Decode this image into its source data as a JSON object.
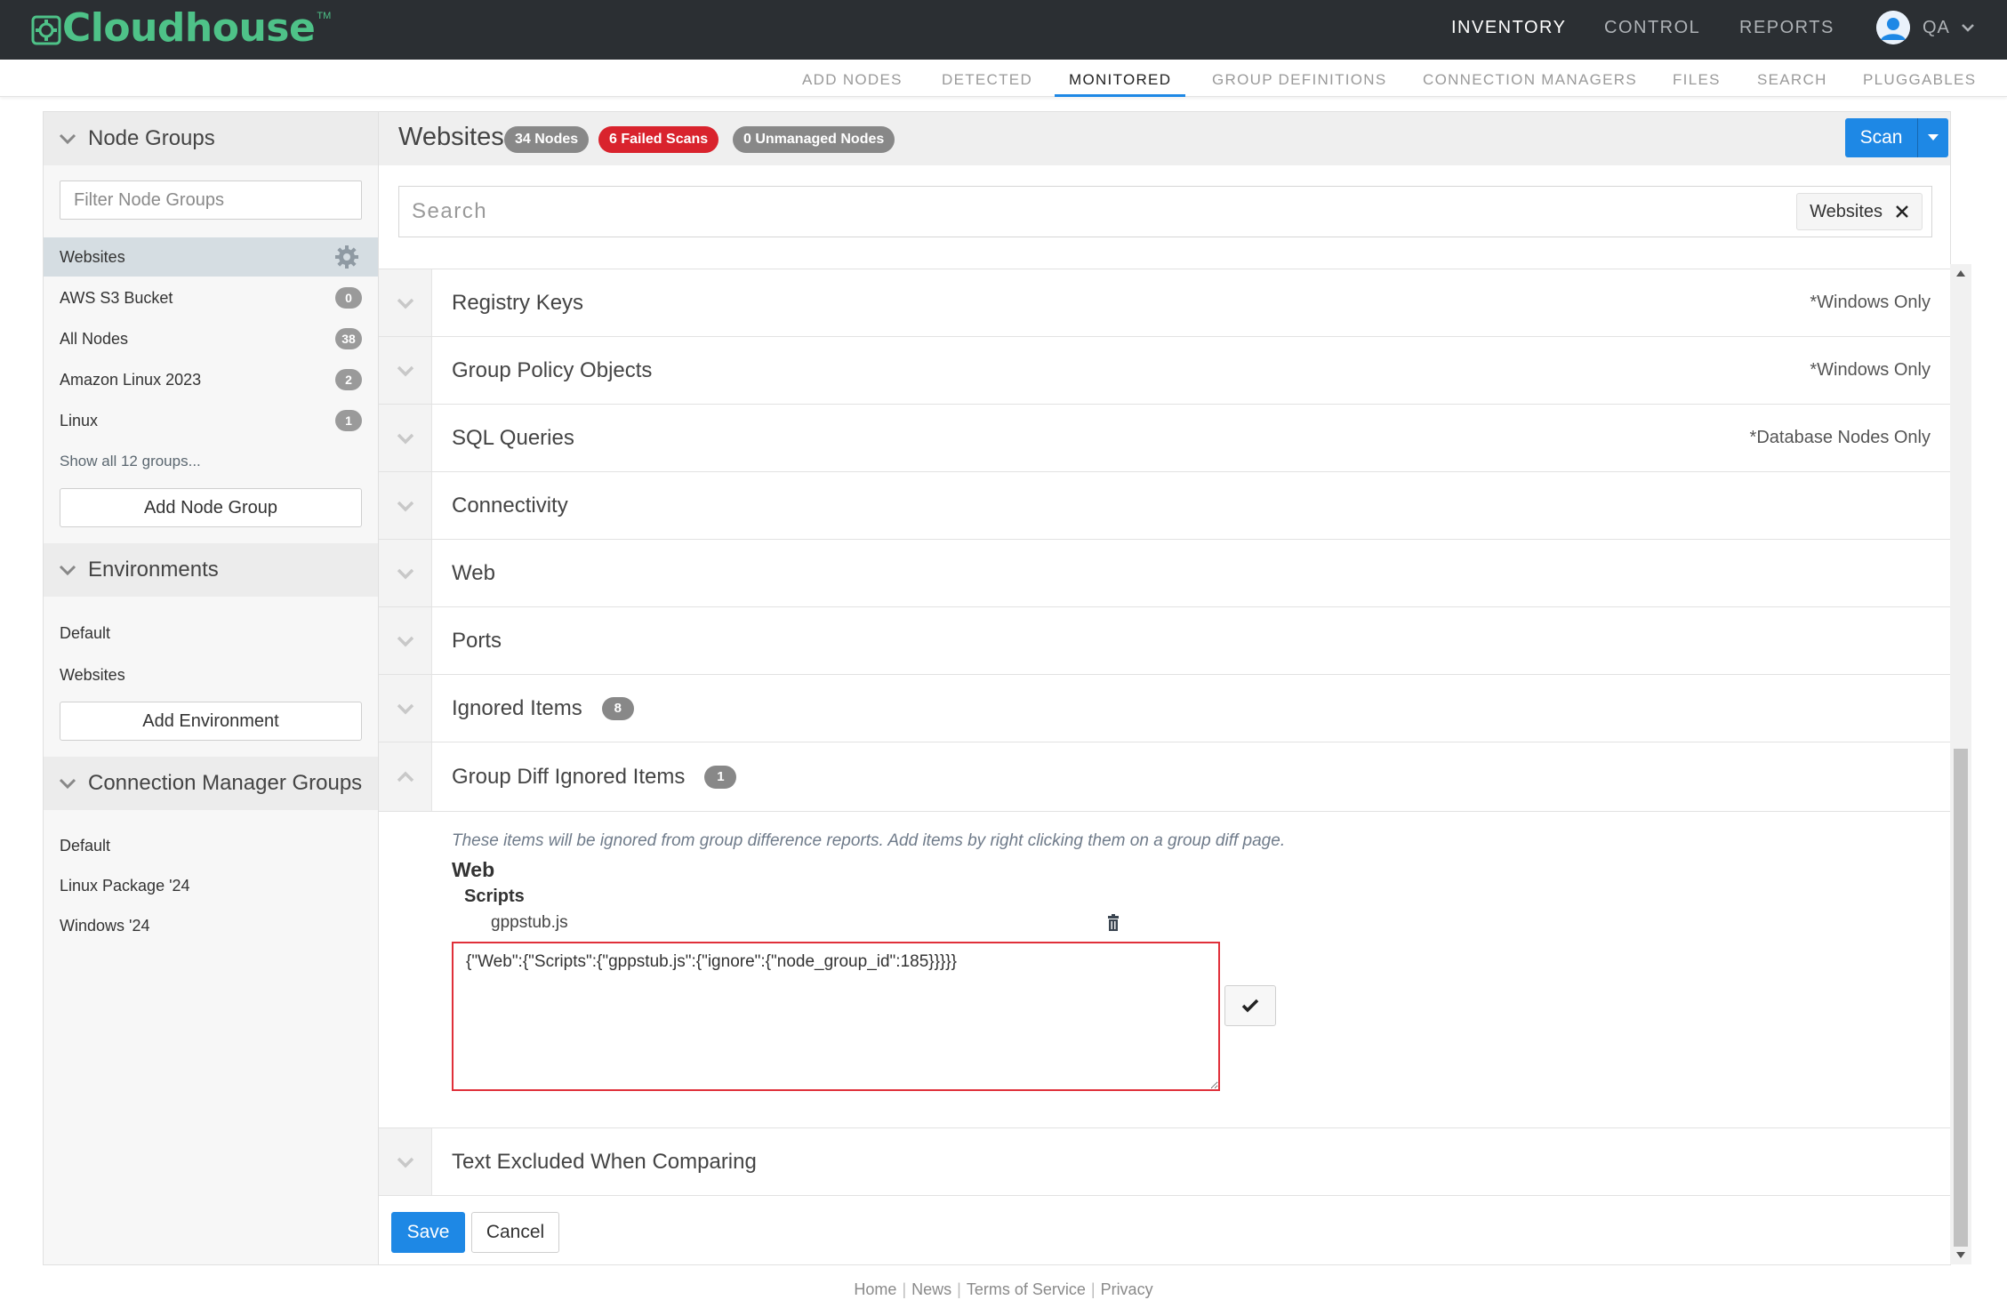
{
  "brand": {
    "name": "Cloudhouse",
    "tm": "TM",
    "color": "#4ec288"
  },
  "topnav": {
    "inventory": "INVENTORY",
    "control": "CONTROL",
    "reports": "REPORTS",
    "user": "QA"
  },
  "subnav": {
    "items": [
      "ADD NODES",
      "DETECTED",
      "MONITORED",
      "GROUP DEFINITIONS",
      "CONNECTION MANAGERS",
      "FILES",
      "SEARCH",
      "PLUGGABLES"
    ],
    "active": "MONITORED"
  },
  "sidebar": {
    "node_groups": {
      "title": "Node Groups",
      "filter_placeholder": "Filter Node Groups",
      "items": [
        {
          "label": "Websites",
          "badge": ""
        },
        {
          "label": "AWS S3 Bucket",
          "badge": "0"
        },
        {
          "label": "All Nodes",
          "badge": "38"
        },
        {
          "label": "Amazon Linux 2023",
          "badge": "2"
        },
        {
          "label": "Linux",
          "badge": "1"
        }
      ],
      "show_all": "Show all 12 groups...",
      "add_button": "Add Node Group"
    },
    "environments": {
      "title": "Environments",
      "items": [
        "Default",
        "Websites"
      ],
      "add_button": "Add Environment"
    },
    "connection_manager_groups": {
      "title": "Connection Manager Groups",
      "items": [
        "Default",
        "Linux Package '24",
        "Windows '24"
      ]
    }
  },
  "main": {
    "title": "Websites",
    "pills": {
      "nodes": "34 Nodes",
      "failed": "6 Failed Scans",
      "unmanaged": "0 Unmanaged Nodes"
    },
    "scan_label": "Scan",
    "search_placeholder": "Search",
    "search_tag": "Websites",
    "rows": [
      {
        "title": "Registry Keys",
        "note": "*Windows Only",
        "badge": ""
      },
      {
        "title": "Group Policy Objects",
        "note": "*Windows Only",
        "badge": ""
      },
      {
        "title": "SQL Queries",
        "note": "*Database Nodes Only",
        "badge": ""
      },
      {
        "title": "Connectivity",
        "note": "",
        "badge": ""
      },
      {
        "title": "Web",
        "note": "",
        "badge": ""
      },
      {
        "title": "Ports",
        "note": "",
        "badge": ""
      },
      {
        "title": "Ignored Items",
        "note": "",
        "badge": "8"
      },
      {
        "title": "Group Diff Ignored Items",
        "note": "",
        "badge": "1"
      }
    ],
    "expanded": {
      "description": "These items will be ignored from group difference reports. Add items by right clicking them on a group diff page.",
      "category": "Web",
      "subcategory": "Scripts",
      "file": "gppstub.js",
      "json_value": "{\"Web\":{\"Scripts\":{\"gppstub.js\":{\"ignore\":{\"node_group_id\":185}}}}}"
    },
    "last_row": {
      "title": "Text Excluded When Comparing"
    },
    "save_label": "Save",
    "cancel_label": "Cancel"
  },
  "footer": {
    "links": [
      "Home",
      "News",
      "Terms of Service",
      "Privacy"
    ]
  },
  "colors": {
    "topbar": "#2b2f33",
    "accent": "#1e88e5",
    "danger": "#d9232d",
    "badge": "#888888"
  }
}
